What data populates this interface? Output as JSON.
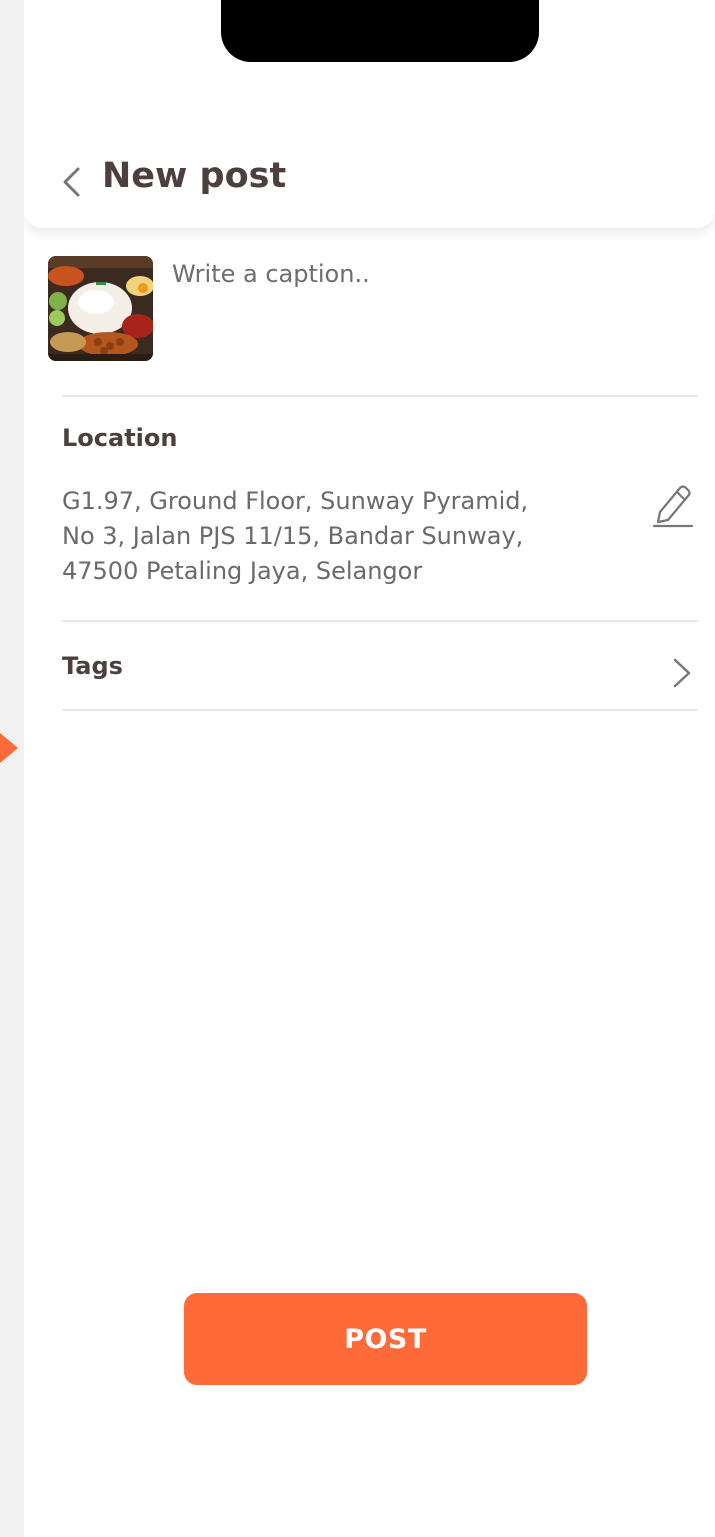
{
  "header": {
    "title": "New post",
    "back_icon": "chevron-left-icon"
  },
  "post": {
    "caption_placeholder": "Write a caption..",
    "image": "food-photo-thumbnail"
  },
  "location": {
    "label": "Location",
    "address_lines": [
      "G1.97, Ground Floor, Sunway Pyramid,",
      "No 3, Jalan PJS 11/15, Bandar Sunway,",
      "47500 Petaling Jaya, Selangor"
    ],
    "edit_icon": "pencil-icon"
  },
  "tags": {
    "label": "Tags",
    "icon": "chevron-right-icon"
  },
  "actions": {
    "post_label": "POST"
  },
  "colors": {
    "accent": "#ff6a39",
    "title_text": "#4c3f3e",
    "teal": "#21b3bf"
  }
}
